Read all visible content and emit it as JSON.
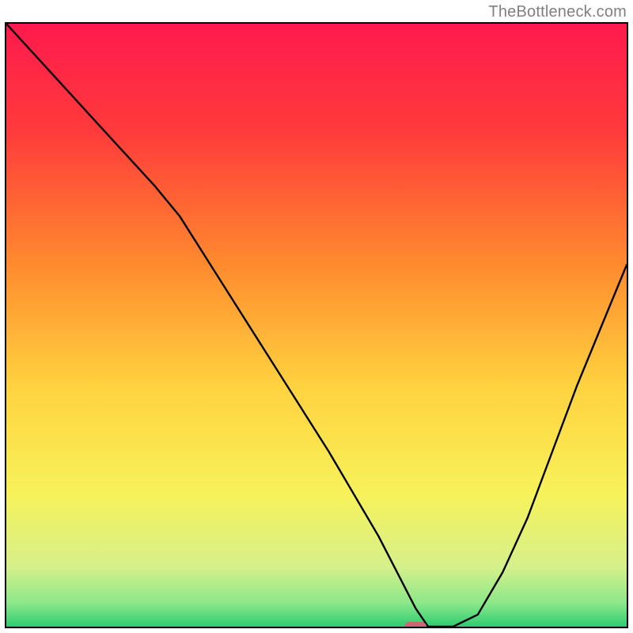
{
  "watermark": "TheBottleneck.com",
  "chart_data": {
    "type": "line",
    "title": "",
    "xlabel": "",
    "ylabel": "",
    "xlim": [
      0,
      100
    ],
    "ylim": [
      0,
      100
    ],
    "x": [
      0,
      8,
      16,
      24,
      28,
      36,
      44,
      52,
      60,
      64,
      66,
      68,
      72,
      76,
      80,
      84,
      88,
      92,
      96,
      100
    ],
    "values": [
      100,
      91,
      82,
      73,
      68,
      55,
      42,
      29,
      15,
      7,
      3,
      0,
      0,
      2,
      9,
      18,
      29,
      40,
      50,
      60
    ],
    "marker": {
      "x": 66,
      "y": 0
    },
    "gradient_stops": [
      {
        "offset": 0.0,
        "color": "#ff1a4d"
      },
      {
        "offset": 0.18,
        "color": "#ff3b3b"
      },
      {
        "offset": 0.4,
        "color": "#ff8b2e"
      },
      {
        "offset": 0.6,
        "color": "#ffd23f"
      },
      {
        "offset": 0.78,
        "color": "#f7f25a"
      },
      {
        "offset": 0.9,
        "color": "#d6f08a"
      },
      {
        "offset": 0.96,
        "color": "#8de88a"
      },
      {
        "offset": 1.0,
        "color": "#2ecc71"
      }
    ]
  }
}
